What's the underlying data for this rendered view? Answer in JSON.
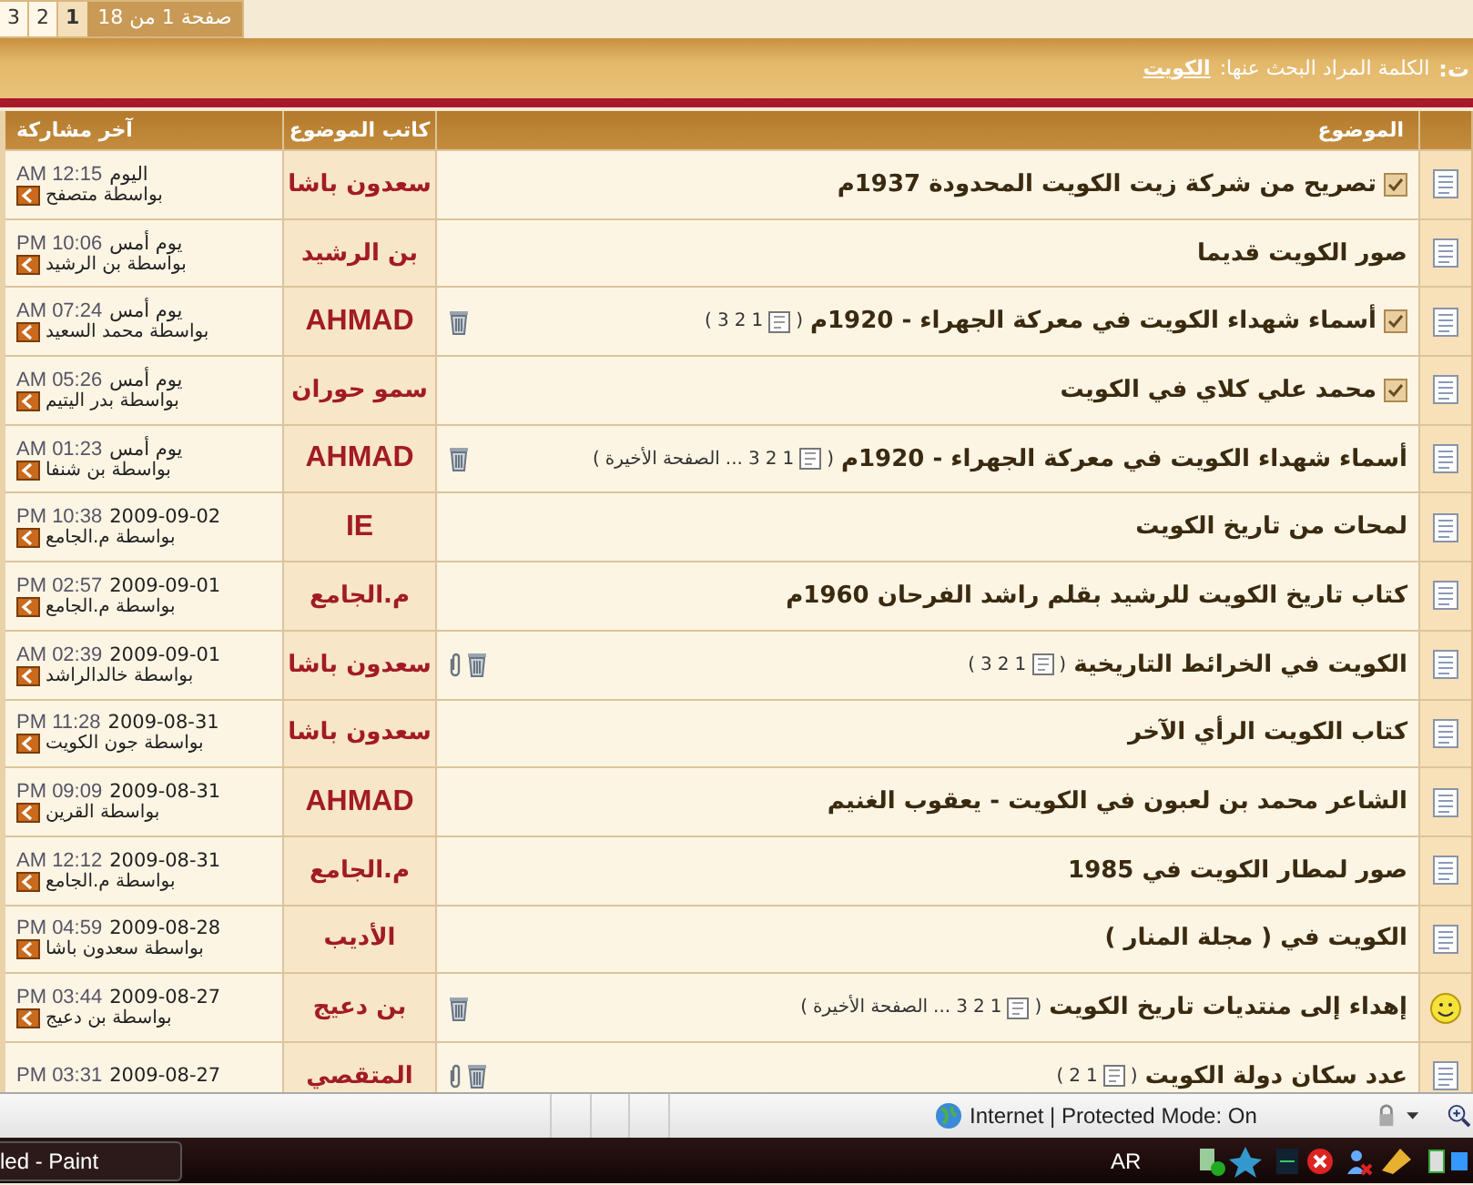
{
  "pager": {
    "label": "صفحة 1 من 18",
    "pages": [
      {
        "label": "1",
        "selected": true
      },
      {
        "label": "2",
        "selected": false
      },
      {
        "label": "3",
        "selected": false
      }
    ]
  },
  "search_bar": {
    "title": "ت:",
    "prompt": "الكلمة المراد البحث عنها:",
    "keyword": "الكويت"
  },
  "table": {
    "columns": [
      "الموضوع",
      "كاتب الموضوع",
      "آخر مشاركة"
    ],
    "rows": [
      {
        "kind": "doc",
        "marked": true,
        "title": "تصريح من شركة زيت الكويت المحدودة 1937م",
        "attachment": false,
        "bin": false,
        "author": "سعدون باشا",
        "date": "اليوم",
        "time": "12:15 AM",
        "by": "بواسطة متصفح"
      },
      {
        "kind": "doc",
        "marked": false,
        "title": "صور الكويت قديما",
        "attachment": false,
        "bin": false,
        "author": "بن الرشيد",
        "date": "يوم أمس",
        "time": "10:06 PM",
        "by": "بواسطة بن الرشيد"
      },
      {
        "kind": "doc",
        "marked": true,
        "title": "أسماء شهداء الكويت في معركة الجهراء - 1920م",
        "pages": {
          "open": "(",
          "links": [
            "1",
            "2",
            "3"
          ],
          "close": ")"
        },
        "attachment": false,
        "bin": true,
        "author": "AHMAD",
        "date": "يوم أمس",
        "time": "07:24 AM",
        "by": "بواسطة محمد السعيد"
      },
      {
        "kind": "doc",
        "marked": true,
        "title": "محمد علي كلاي في الكويت",
        "attachment": false,
        "bin": false,
        "author": "سمو حوران",
        "date": "يوم أمس",
        "time": "05:26 AM",
        "by": "بواسطة بدر اليتيم"
      },
      {
        "kind": "doc",
        "marked": false,
        "title": "أسماء شهداء الكويت في معركة الجهراء - 1920م",
        "pages": {
          "open": "(",
          "links": [
            "1",
            "2",
            "3"
          ],
          "more": "...",
          "last": "الصفحة الأخيرة",
          "close": ")"
        },
        "attachment": false,
        "bin": true,
        "author": "AHMAD",
        "date": "يوم أمس",
        "time": "01:23 AM",
        "by": "بواسطة بن شنفا"
      },
      {
        "kind": "doc",
        "marked": false,
        "title": "لمحات من تاريخ الكويت",
        "attachment": false,
        "bin": false,
        "author": "IE",
        "date": "2009-09-02",
        "time": "10:38 PM",
        "by": "بواسطة م.الجامع"
      },
      {
        "kind": "doc",
        "marked": false,
        "title": "كتاب تاريخ الكويت للرشيد بقلم راشد الفرحان 1960م",
        "attachment": false,
        "bin": false,
        "author": "م.الجامع",
        "date": "2009-09-01",
        "time": "02:57 PM",
        "by": "بواسطة م.الجامع"
      },
      {
        "kind": "doc",
        "marked": false,
        "title": "الكويت في الخرائط التاريخية",
        "pages": {
          "open": "(",
          "links": [
            "1",
            "2",
            "3"
          ],
          "close": ")"
        },
        "attachment": true,
        "bin": true,
        "author": "سعدون باشا",
        "date": "2009-09-01",
        "time": "02:39 AM",
        "by": "بواسطة خالدالراشد"
      },
      {
        "kind": "doc",
        "marked": false,
        "title": "كتاب الكويت الرأي الآخر",
        "attachment": false,
        "bin": false,
        "author": "سعدون باشا",
        "date": "2009-08-31",
        "time": "11:28 PM",
        "by": "بواسطة جون الكويت"
      },
      {
        "kind": "doc",
        "marked": false,
        "title": "الشاعر محمد بن لعبون في الكويت - يعقوب الغنيم",
        "attachment": false,
        "bin": false,
        "author": "AHMAD",
        "date": "2009-08-31",
        "time": "09:09 PM",
        "by": "بواسطة القرين"
      },
      {
        "kind": "doc",
        "marked": false,
        "title": "صور لمطار الكويت في 1985",
        "attachment": false,
        "bin": false,
        "author": "م.الجامع",
        "date": "2009-08-31",
        "time": "12:12 AM",
        "by": "بواسطة م.الجامع"
      },
      {
        "kind": "doc",
        "marked": false,
        "title": "الكويت في ( مجلة المنار )",
        "attachment": false,
        "bin": false,
        "author": "الأديب",
        "date": "2009-08-28",
        "time": "04:59 PM",
        "by": "بواسطة سعدون باشا"
      },
      {
        "kind": "smiley",
        "marked": false,
        "title": "إهداء إلى منتديات تاريخ الكويت",
        "pages": {
          "open": "(",
          "links": [
            "1",
            "2",
            "3"
          ],
          "more": "...",
          "last": "الصفحة الأخيرة",
          "close": ")"
        },
        "attachment": false,
        "bin": true,
        "author": "بن دعيج",
        "date": "2009-08-27",
        "time": "03:44 PM",
        "by": "بواسطة بن دعيج"
      },
      {
        "kind": "doc",
        "marked": false,
        "title": "عدد سكان دولة الكويت",
        "pages": {
          "open": "(",
          "links": [
            "1",
            "2"
          ],
          "close": ")"
        },
        "attachment": true,
        "bin": true,
        "author": "المتقصي",
        "date": "2009-08-27",
        "time": "03:31 PM"
      }
    ]
  },
  "status_bar": {
    "zone": "Internet | Protected Mode: On"
  },
  "taskbar": {
    "window": "led - Paint",
    "language": "AR"
  }
}
